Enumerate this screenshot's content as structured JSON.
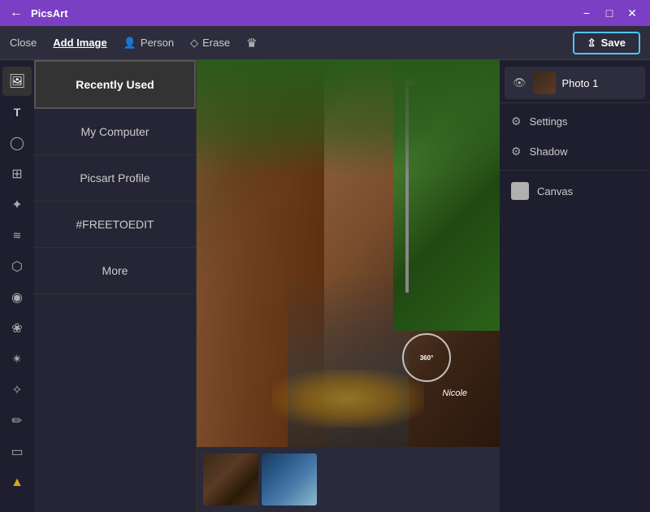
{
  "titleBar": {
    "appName": "PicsArt",
    "backIcon": "←",
    "minimizeIcon": "−",
    "maximizeIcon": "□",
    "closeIcon": "✕"
  },
  "toolbar": {
    "closeLabel": "Close",
    "addImageLabel": "Add Image",
    "personLabel": "Person",
    "eraseLabel": "Erase",
    "saveLabel": "Save"
  },
  "addImagePanel": {
    "menuItems": [
      {
        "id": "recently-used",
        "label": "Recently Used",
        "active": true
      },
      {
        "id": "my-computer",
        "label": "My Computer",
        "active": false
      },
      {
        "id": "picsart-profile",
        "label": "Picsart Profile",
        "active": false
      },
      {
        "id": "free-to-edit",
        "label": "#FREETOEDIT",
        "active": false
      },
      {
        "id": "more",
        "label": "More",
        "active": false
      }
    ]
  },
  "rightPanel": {
    "layerName": "Photo 1",
    "settingsLabel": "Settings",
    "shadowLabel": "Shadow",
    "canvasLabel": "Canvas"
  },
  "canvas": {
    "overlay360Label": "360°",
    "overlayName": "Nicole"
  },
  "sidebarIcons": [
    {
      "id": "image-icon",
      "symbol": "🖼",
      "active": true
    },
    {
      "id": "text-icon",
      "symbol": "T",
      "active": false
    },
    {
      "id": "brush-icon",
      "symbol": "◯",
      "active": false
    },
    {
      "id": "sticker-icon",
      "symbol": "📋",
      "active": false
    },
    {
      "id": "effects-icon",
      "symbol": "✦",
      "active": false
    },
    {
      "id": "adjust-icon",
      "symbol": "≋",
      "active": false
    },
    {
      "id": "filter-icon",
      "symbol": "⬡",
      "active": false
    },
    {
      "id": "face-icon",
      "symbol": "◎",
      "active": false
    },
    {
      "id": "blend-icon",
      "symbol": "❀",
      "active": false
    },
    {
      "id": "magic-icon",
      "symbol": "✦",
      "active": false
    },
    {
      "id": "sparkle-icon",
      "symbol": "✧",
      "active": false
    },
    {
      "id": "retouch-icon",
      "symbol": "✏",
      "active": false
    },
    {
      "id": "crop-icon",
      "symbol": "▭",
      "active": false
    },
    {
      "id": "award-icon",
      "symbol": "▲",
      "active": false
    }
  ]
}
